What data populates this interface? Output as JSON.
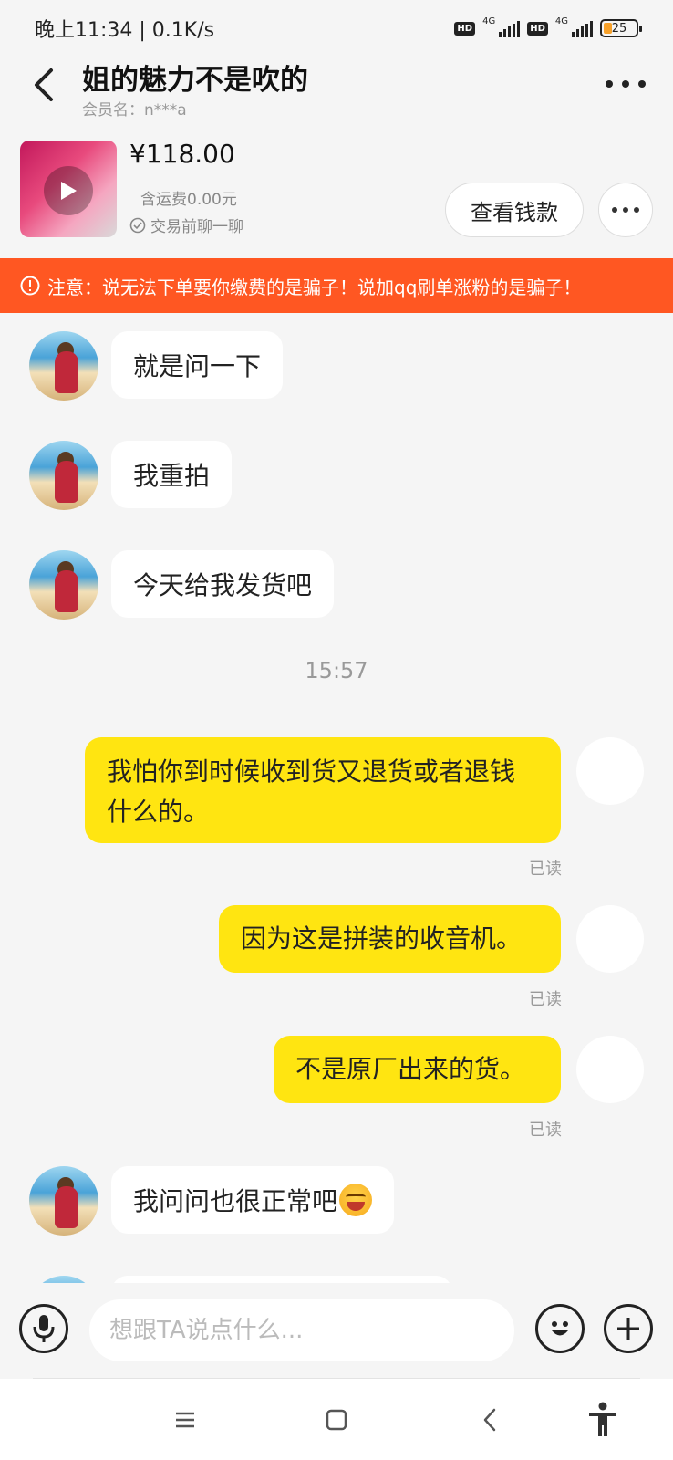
{
  "status_bar": {
    "time": "晚上11:34 | 0.1K/s",
    "hd1": "HD",
    "net1": "4G",
    "hd2": "HD",
    "net2": "4G",
    "battery": "25",
    "battery_level": 0.25
  },
  "header": {
    "title": "姐的魅力不是吹的",
    "member_name": "会员名：n***a"
  },
  "product": {
    "price": "¥118.00",
    "shipping": "含运费0.00元",
    "chat_before": "交易前聊一聊",
    "view_button": "查看钱款"
  },
  "warning": {
    "text": "注意：说无法下单要你缴费的是骗子！说加qq刷单涨粉的是骗子！"
  },
  "messages": [
    {
      "from": "other",
      "text": "就是问一下"
    },
    {
      "from": "other",
      "text": "我重拍"
    },
    {
      "from": "other",
      "text": "今天给我发货吧"
    },
    {
      "type": "time",
      "text": "15:57"
    },
    {
      "from": "me",
      "text": "我怕你到时候收到货又退货或者退钱什么的。",
      "status": "已读"
    },
    {
      "from": "me",
      "text": "因为这是拼装的收音机。",
      "status": "已读"
    },
    {
      "from": "me",
      "text": "不是原厂出来的货。",
      "status": "已读"
    },
    {
      "from": "other",
      "text": "我问问也很正常吧",
      "emoji": "laughing-squint-emoji"
    }
  ],
  "input_bar": {
    "placeholder": "想跟TA说点什么..."
  },
  "colors": {
    "my_bubble": "#ffe511",
    "warning_bg": "#ff5722",
    "battery_fill": "#f7a12a"
  }
}
